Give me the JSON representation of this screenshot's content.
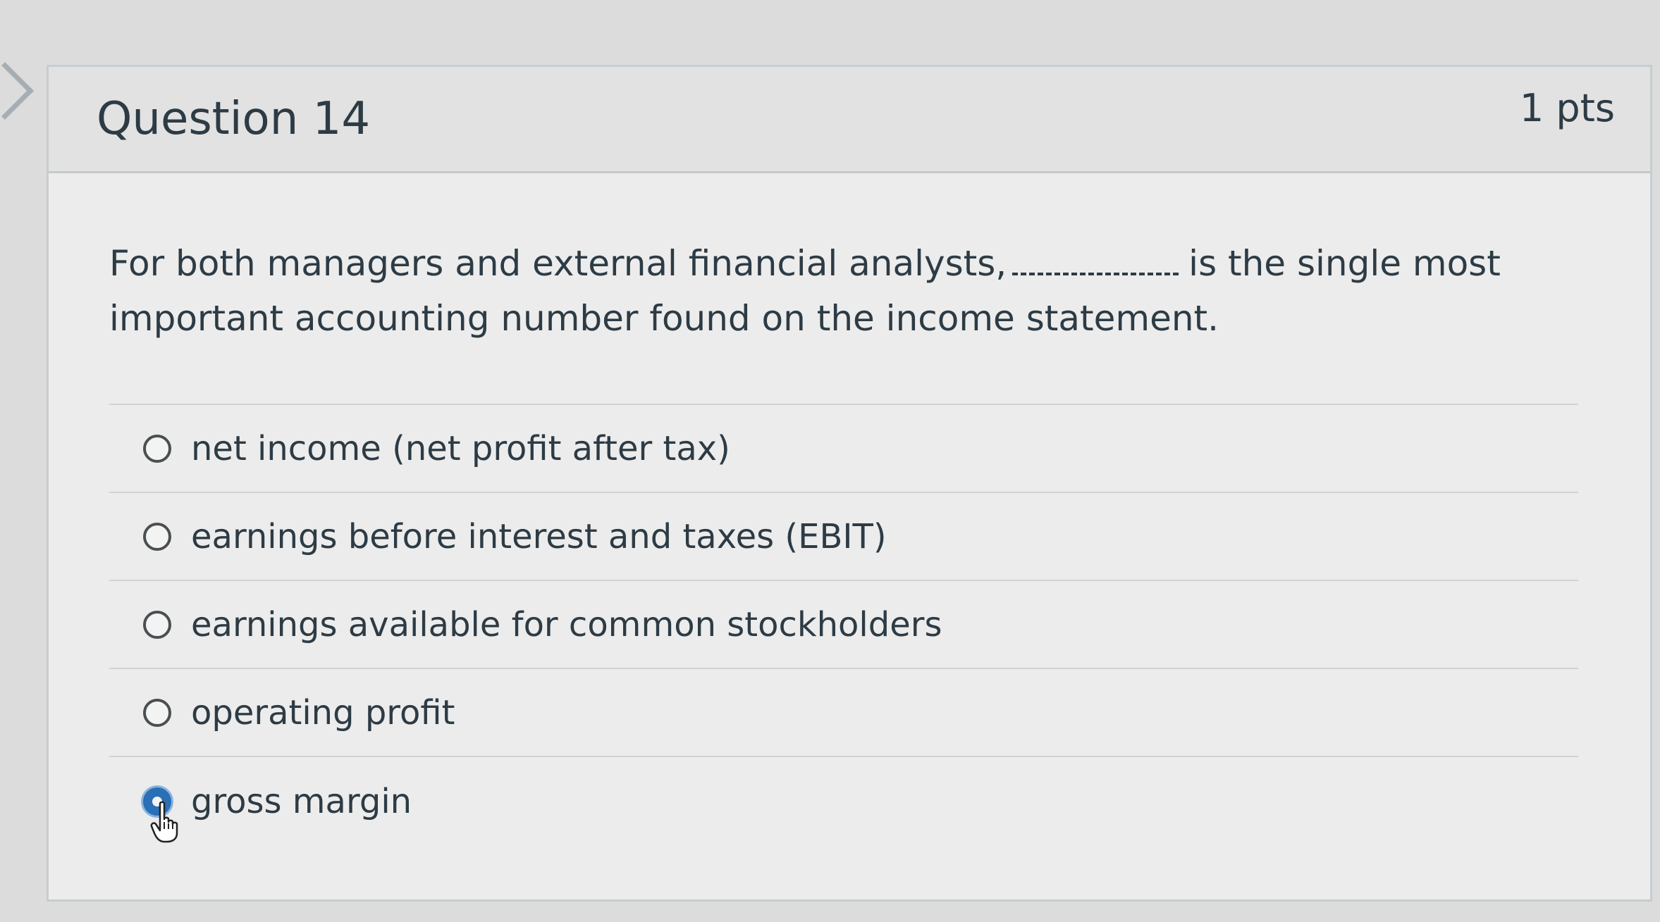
{
  "question": {
    "title": "Question 14",
    "points": "1 pts",
    "text_before_blank": "For both managers and external financial analysts,",
    "text_after_blank": "is the single most important accounting number found on the income statement."
  },
  "answers": [
    {
      "label": "net income (net profit after tax)",
      "selected": false
    },
    {
      "label": "earnings before interest and taxes (EBIT)",
      "selected": false
    },
    {
      "label": "earnings available for common stockholders",
      "selected": false
    },
    {
      "label": "operating profit",
      "selected": false
    },
    {
      "label": "gross margin",
      "selected": true
    }
  ],
  "colors": {
    "text": "#2d3b45",
    "accent": "#2b6fb6"
  },
  "icons": {
    "nav": "chevron-right-icon",
    "pointer": "hand-pointer-icon"
  }
}
